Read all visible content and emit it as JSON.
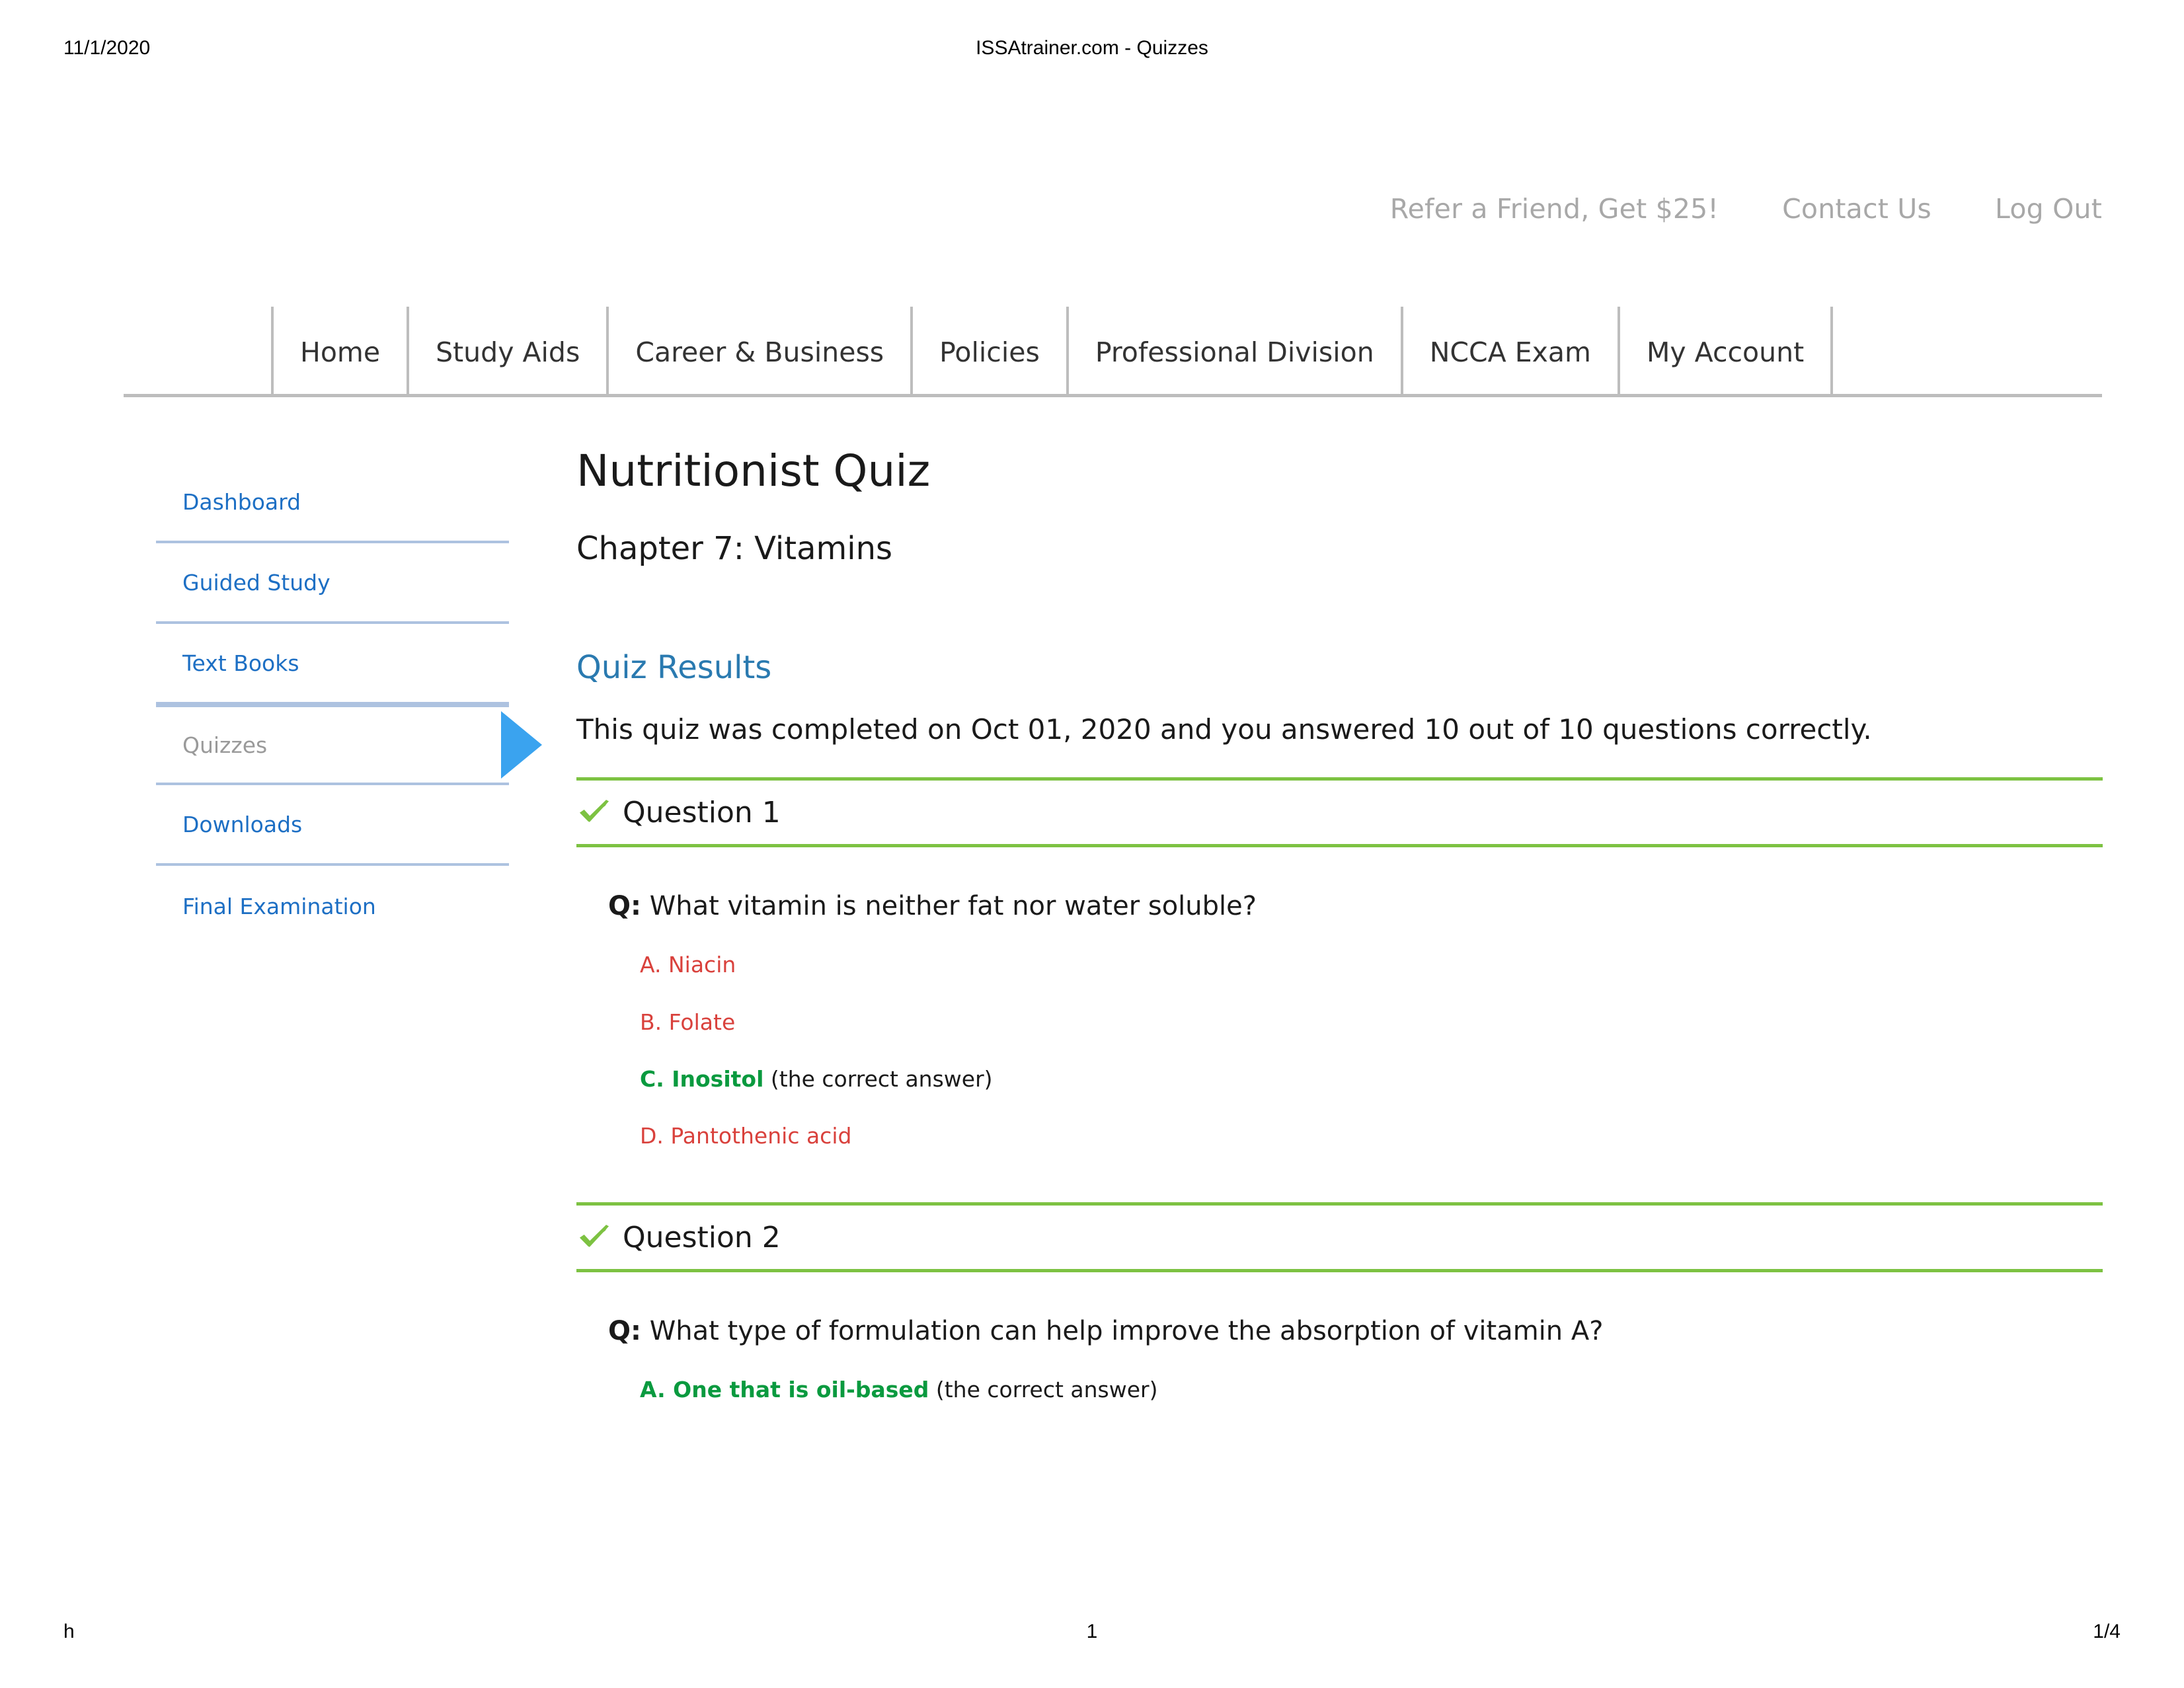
{
  "print_header": {
    "date": "11/1/2020",
    "title": "ISSAtrainer.com - Quizzes"
  },
  "print_footer": {
    "left": "h",
    "center": "1",
    "right": "1/4"
  },
  "utility_links": [
    {
      "label": "Refer a Friend, Get $25!"
    },
    {
      "label": "Contact Us"
    },
    {
      "label": "Log Out"
    }
  ],
  "nav": {
    "items": [
      {
        "label": "Home"
      },
      {
        "label": "Study Aids"
      },
      {
        "label": "Career & Business"
      },
      {
        "label": "Policies"
      },
      {
        "label": "Professional Division"
      },
      {
        "label": "NCCA Exam"
      },
      {
        "label": "My Account"
      }
    ]
  },
  "sidebar": {
    "items": [
      {
        "label": "Dashboard",
        "active": false
      },
      {
        "label": "Guided Study",
        "active": false
      },
      {
        "label": "Text Books",
        "active": false
      },
      {
        "label": "Quizzes",
        "active": true
      },
      {
        "label": "Downloads",
        "active": false
      },
      {
        "label": "Final Examination",
        "active": false
      }
    ]
  },
  "main": {
    "title": "Nutritionist Quiz",
    "subtitle": "Chapter 7: Vitamins",
    "results_heading": "Quiz Results",
    "results_text": "This quiz was completed on Oct 01, 2020 and you answered 10 out of 10 questions correctly.",
    "questions": [
      {
        "title": "Question 1",
        "q_label": "Q:",
        "prompt": "What vitamin is neither fat nor water soluble?",
        "answers": [
          {
            "text": "A. Niacin",
            "correct": false,
            "note": ""
          },
          {
            "text": "B. Folate",
            "correct": false,
            "note": ""
          },
          {
            "text": "C. Inositol",
            "correct": true,
            "note": " (the correct answer)"
          },
          {
            "text": "D. Pantothenic acid",
            "correct": false,
            "note": ""
          }
        ]
      },
      {
        "title": "Question 2",
        "q_label": "Q:",
        "prompt": "What type of formulation can help improve the absorption of vitamin A?",
        "answers": [
          {
            "text": "A. One that is oil-based",
            "correct": true,
            "note": " (the correct answer)"
          }
        ]
      }
    ]
  },
  "colors": {
    "link_blue": "#1d6fc4",
    "accent_blue": "#3aa3ef",
    "heading_blue": "#2a7ab0",
    "rule_green": "#7dc242",
    "correct_green": "#0a9a3f",
    "wrong_red": "#d9413c",
    "sidebar_rule": "#adc2e0",
    "nav_rule": "#bdbdbd",
    "utility_gray": "#a8a8a8"
  },
  "icons": {
    "check": "check-icon",
    "active_pointer": "triangle-right-icon"
  }
}
